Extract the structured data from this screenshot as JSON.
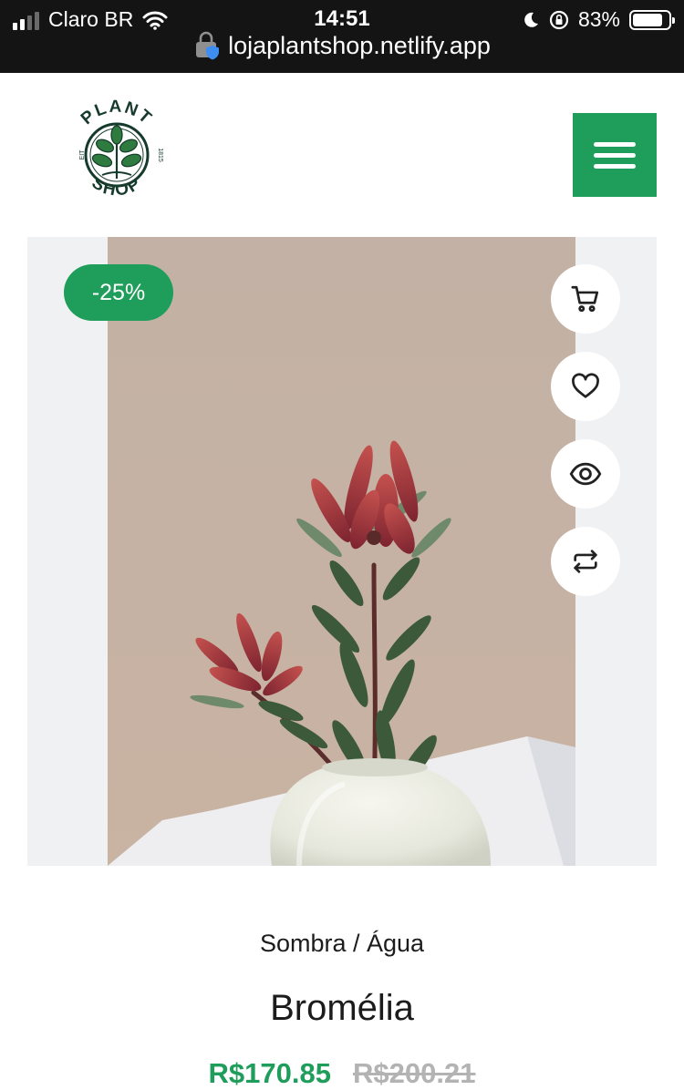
{
  "status_bar": {
    "carrier": "Claro BR",
    "time": "14:51",
    "battery": "83%",
    "battery_level": 0.83,
    "url": "lojaplantshop.netlify.app"
  },
  "header": {
    "logo_top": "PLANT",
    "logo_bottom": "SHOP",
    "logo_left": "EIT",
    "logo_right": "1815",
    "menu_icon": "hamburger-icon"
  },
  "product": {
    "discount": "-25%",
    "category": "Sombra / Água",
    "name": "Bromélia",
    "price": "R$170.85",
    "old_price": "R$200.21",
    "actions": [
      {
        "name": "cart",
        "icon": "cart-icon"
      },
      {
        "name": "wishlist",
        "icon": "heart-icon"
      },
      {
        "name": "quick-view",
        "icon": "eye-icon"
      },
      {
        "name": "compare",
        "icon": "compare-icon"
      }
    ]
  },
  "colors": {
    "brand_green": "#1f9d5a",
    "status_bar": "#141414",
    "old_price": "#b3b3b3",
    "card_bg": "#f0f1f3"
  }
}
